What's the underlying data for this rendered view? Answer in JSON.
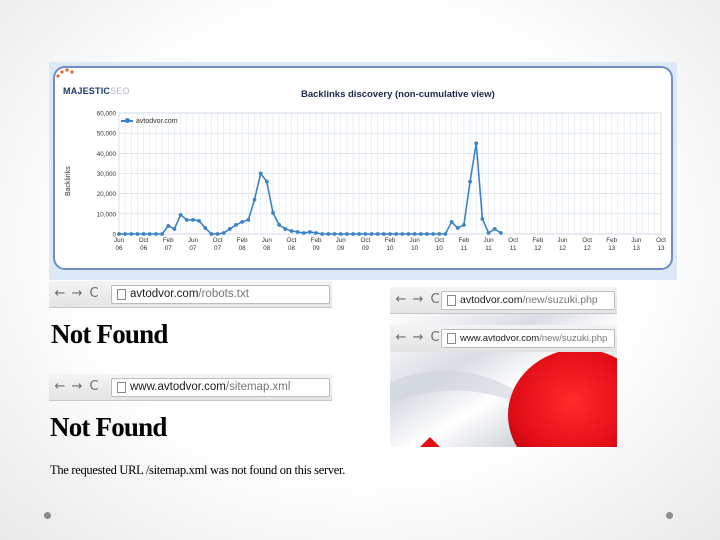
{
  "chart": {
    "logo_main": "MAJESTIC",
    "logo_sub": "SEO",
    "title": "Backlinks discovery (non-cumulative view)",
    "legend": "avtodvor.com",
    "ylabel": "Backlinks",
    "y_ticks": [
      "60,000",
      "50,000",
      "40,000",
      "30,000",
      "20,000",
      "10,000",
      "0"
    ],
    "x_months": [
      "Jun",
      "Oct",
      "Feb",
      "Jun",
      "Oct",
      "Feb",
      "Jun",
      "Oct",
      "Feb",
      "Jun",
      "Oct",
      "Feb",
      "Jun",
      "Oct",
      "Feb",
      "Jun",
      "Oct",
      "Feb",
      "Jun",
      "Oct",
      "Feb",
      "Jun",
      "Oct"
    ],
    "x_years": [
      "06",
      "06",
      "07",
      "07",
      "07",
      "08",
      "08",
      "08",
      "09",
      "09",
      "09",
      "10",
      "10",
      "10",
      "11",
      "11",
      "11",
      "12",
      "12",
      "12",
      "13",
      "13",
      "13"
    ],
    "line_color": "#3b82c9"
  },
  "chart_data": {
    "type": "line",
    "title": "Backlinks discovery (non-cumulative view)",
    "xlabel": "",
    "ylabel": "Backlinks",
    "ylim": [
      0,
      60000
    ],
    "grid": true,
    "legend_position": "top-left",
    "categories": [
      "Jun 06",
      "Oct 06",
      "Feb 07",
      "Jun 07",
      "Oct 07",
      "Feb 08",
      "Jun 08",
      "Oct 08",
      "Feb 09",
      "Jun 09",
      "Oct 09",
      "Feb 10",
      "Jun 10",
      "Oct 10",
      "Feb 11",
      "Jun 11",
      "Oct 11",
      "Feb 12",
      "Jun 12",
      "Oct 12",
      "Feb 13",
      "Jun 13",
      "Oct 13"
    ],
    "series": [
      {
        "name": "avtodvor.com",
        "points": [
          [
            6.0,
            0
          ],
          [
            6.25,
            0
          ],
          [
            6.5,
            0
          ],
          [
            6.75,
            0
          ],
          [
            7.0,
            0
          ],
          [
            7.25,
            0
          ],
          [
            7.5,
            0
          ],
          [
            7.75,
            0
          ],
          [
            8.0,
            4000
          ],
          [
            8.25,
            2500
          ],
          [
            8.5,
            9500
          ],
          [
            8.75,
            7000
          ],
          [
            9.0,
            7000
          ],
          [
            9.25,
            6500
          ],
          [
            9.5,
            3000
          ],
          [
            9.75,
            0
          ],
          [
            10.0,
            0
          ],
          [
            10.25,
            500
          ],
          [
            10.5,
            2500
          ],
          [
            10.75,
            4500
          ],
          [
            11.0,
            6000
          ],
          [
            11.25,
            7000
          ],
          [
            11.5,
            17000
          ],
          [
            11.75,
            30000
          ],
          [
            12.0,
            26000
          ],
          [
            12.25,
            10500
          ],
          [
            12.5,
            4500
          ],
          [
            12.75,
            2500
          ],
          [
            13.0,
            1500
          ],
          [
            13.25,
            1000
          ],
          [
            13.5,
            500
          ],
          [
            13.75,
            1000
          ],
          [
            14.0,
            500
          ],
          [
            14.25,
            0
          ],
          [
            14.5,
            0
          ],
          [
            14.75,
            0
          ],
          [
            15.0,
            0
          ],
          [
            15.25,
            0
          ],
          [
            15.5,
            0
          ],
          [
            15.75,
            0
          ],
          [
            16.0,
            0
          ],
          [
            16.25,
            0
          ],
          [
            16.5,
            0
          ],
          [
            16.75,
            0
          ],
          [
            17.0,
            0
          ],
          [
            17.25,
            0
          ],
          [
            17.5,
            0
          ],
          [
            17.75,
            0
          ],
          [
            18.0,
            0
          ],
          [
            18.25,
            0
          ],
          [
            18.5,
            0
          ],
          [
            18.75,
            0
          ],
          [
            19.0,
            0
          ],
          [
            19.25,
            0
          ],
          [
            19.5,
            6000
          ],
          [
            19.75,
            3000
          ],
          [
            20.0,
            4500
          ],
          [
            20.25,
            26000
          ],
          [
            20.5,
            45000
          ],
          [
            20.75,
            7500
          ],
          [
            21.0,
            500
          ],
          [
            21.25,
            2500
          ],
          [
            21.5,
            500
          ]
        ]
      }
    ]
  },
  "browser1": {
    "url_host": "avtodvor.com",
    "url_path": "/robots.txt"
  },
  "notfound1": "Not Found",
  "browser2": {
    "url_host": "www.avtodvor.com",
    "url_path": "/sitemap.xml"
  },
  "notfound2": "Not Found",
  "notfound2_msg": "The requested URL /sitemap.xml was not found on this server.",
  "browser3": {
    "url_host": "avtodvor.com",
    "url_path": "/new/suzuki.php"
  },
  "browser4": {
    "url_host": "www.avtodvor.com",
    "url_path": "/new/suzuki.php"
  },
  "nav": {
    "back": "←",
    "forward": "→",
    "reload": "C"
  }
}
